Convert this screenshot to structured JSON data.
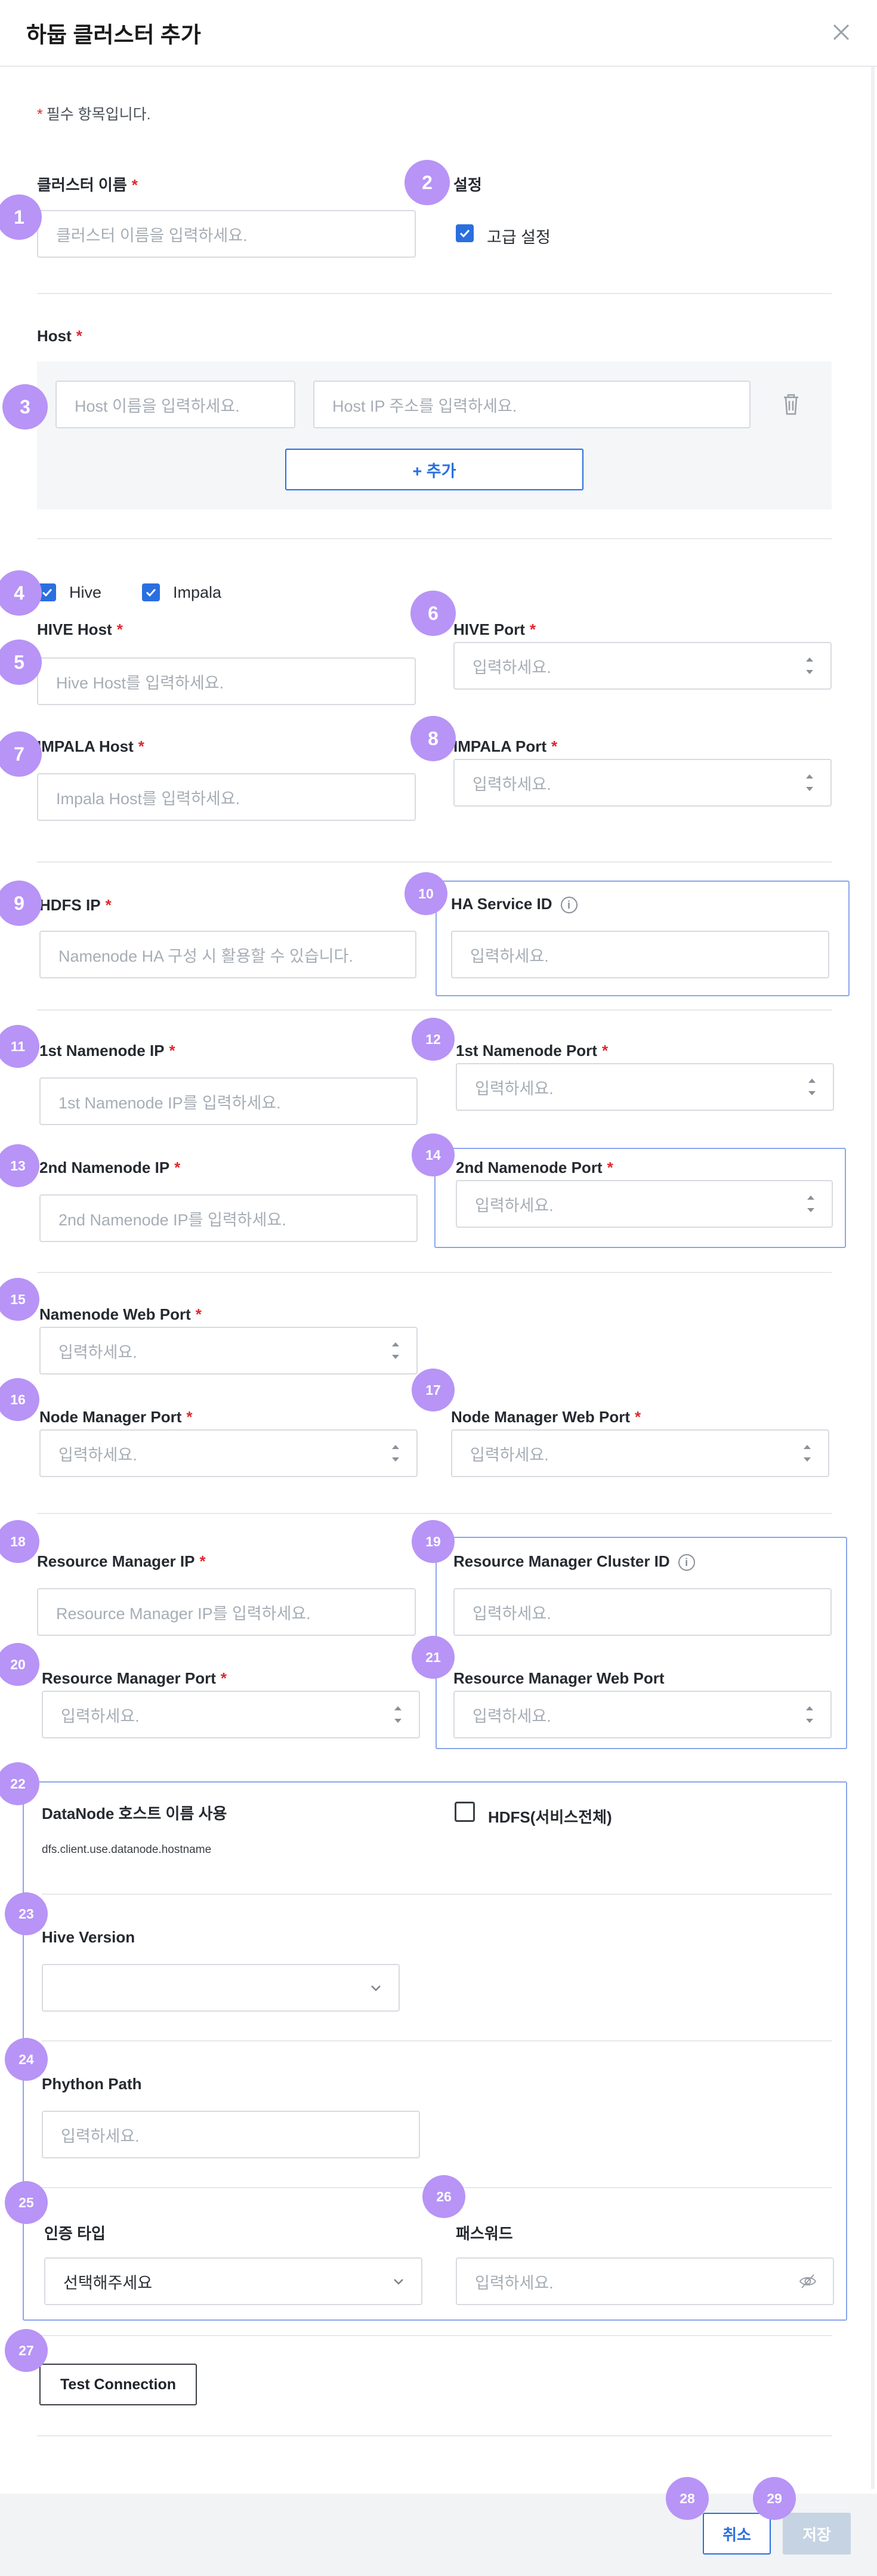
{
  "header": {
    "title": "하둡 클러스터 추가",
    "close_icon": "close-icon"
  },
  "required_note": {
    "marker": "*",
    "text": "필수 항목입니다."
  },
  "req": "*",
  "badges": [
    "1",
    "2",
    "3",
    "4",
    "5",
    "6",
    "7",
    "8",
    "9",
    "10",
    "11",
    "12",
    "13",
    "14",
    "15",
    "16",
    "17",
    "18",
    "19",
    "20",
    "21",
    "22",
    "23",
    "24",
    "25",
    "26",
    "27",
    "28",
    "29"
  ],
  "cluster": {
    "label": "클러스터 이름",
    "placeholder": "클러스터 이름을 입력하세요."
  },
  "settings": {
    "label": "설정",
    "advanced": "고급 설정",
    "advanced_checked": true
  },
  "host": {
    "label": "Host",
    "name_placeholder": "Host 이름을 입력하세요.",
    "ip_placeholder": "Host IP 주소를 입력하세요.",
    "add_label": "+ 추가"
  },
  "services": {
    "hive": "Hive",
    "impala": "Impala"
  },
  "hive_host": {
    "label": "HIVE Host",
    "placeholder": "Hive Host를 입력하세요."
  },
  "hive_port": {
    "label": "HIVE Port",
    "placeholder": "입력하세요."
  },
  "impala_host": {
    "label": "IMPALA Host",
    "placeholder": "Impala Host를 입력하세요."
  },
  "impala_port": {
    "label": "IMPALA Port",
    "placeholder": "입력하세요."
  },
  "hdfs_ip": {
    "label": "HDFS IP",
    "placeholder": "Namenode HA 구성 시 활용할 수 있습니다."
  },
  "ha_service": {
    "label": "HA Service ID",
    "placeholder": "입력하세요."
  },
  "nn1_ip": {
    "label": "1st Namenode IP",
    "placeholder": "1st Namenode IP를 입력하세요."
  },
  "nn1_port": {
    "label": "1st Namenode Port",
    "placeholder": "입력하세요."
  },
  "nn2_ip": {
    "label": "2nd Namenode IP",
    "placeholder": "2nd Namenode IP를 입력하세요."
  },
  "nn2_port": {
    "label": "2nd Namenode Port",
    "placeholder": "입력하세요."
  },
  "nn_web_port": {
    "label": "Namenode Web Port",
    "placeholder": "입력하세요."
  },
  "nm_port": {
    "label": "Node Manager Port",
    "placeholder": "입력하세요."
  },
  "nm_web_port": {
    "label": "Node Manager Web Port",
    "placeholder": "입력하세요."
  },
  "rm_ip": {
    "label": "Resource Manager IP",
    "placeholder": "Resource Manager IP를 입력하세요."
  },
  "rm_cluster": {
    "label": "Resource Manager Cluster ID",
    "placeholder": "입력하세요."
  },
  "rm_port": {
    "label": "Resource Manager Port",
    "placeholder": "입력하세요."
  },
  "rm_web_port": {
    "label": "Resource Manager Web Port",
    "placeholder": "입력하세요."
  },
  "datanode": {
    "label": "DataNode 호스트 이름 사용",
    "sub": "dfs.client.use.datanode.hostname",
    "hdfs_label": "HDFS(서비스전체)"
  },
  "hive_version": {
    "label": "Hive Version",
    "value": ""
  },
  "python": {
    "label": "Phython Path",
    "placeholder": "입력하세요."
  },
  "auth": {
    "label": "인증 타입",
    "value": "선택해주세요"
  },
  "password": {
    "label": "패스워드",
    "placeholder": "입력하세요."
  },
  "test_connection": "Test Connection",
  "footer": {
    "cancel": "취소",
    "save": "저장"
  },
  "colors": {
    "accent": "#2a6fe0",
    "badge": "#b794f6",
    "required": "#e0282e",
    "highlight_border": "#8aa6ec"
  }
}
